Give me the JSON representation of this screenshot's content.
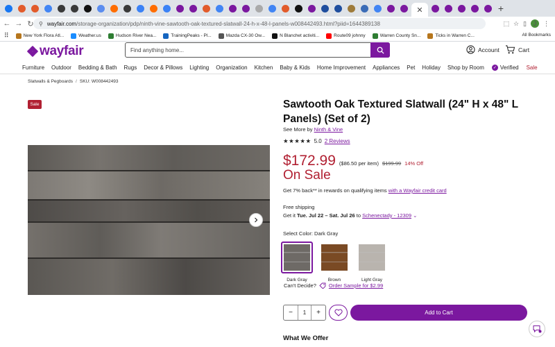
{
  "browser": {
    "tab_colors": [
      "#1877f2",
      "#e25b2b",
      "#e25b2b",
      "#4285f4",
      "#3a3a3a",
      "#3a3a3a",
      "#111111",
      "#5b8def",
      "#ff6d00",
      "#3a3a3a",
      "#3b82f6",
      "#ff6d00",
      "#3b82f6",
      "#7b189f",
      "#7b189f",
      "#e25b2b",
      "#4285f4",
      "#7b189f",
      "#7b189f",
      "#aaaaaa",
      "#4285f4",
      "#e25b2b",
      "#111111",
      "#7b189f",
      "#1f4e9e",
      "#1f4e9e",
      "#9e7b3b",
      "#3b6cb7",
      "#4285f4",
      "#7b189f",
      "#7b189f",
      "#7b189f",
      "#7b189f",
      "#7b189f",
      "#7b189f",
      "#7b189f",
      "#7b189f"
    ],
    "url_host": "wayfair.com",
    "url_path": "/storage-organization/pdp/ninth-vine-sawtooth-oak-textured-slatwall-24-h-x-48-l-panels-w008442493.html?piid=1644389138",
    "profile_initial": "J",
    "bookmarks": [
      {
        "label": "New York Flora Atl...",
        "color": "#b6761d"
      },
      {
        "label": "Weather.us",
        "color": "#1a8cff"
      },
      {
        "label": "Hudson River Nea...",
        "color": "#2e7d32"
      },
      {
        "label": "TrainingPeaks - Pl...",
        "color": "#1565c0"
      },
      {
        "label": "Mazda CX-30 Ow...",
        "color": "#555555"
      },
      {
        "label": "N Blanchet activiti...",
        "color": "#111111"
      },
      {
        "label": "Route09 johnny",
        "color": "#ff0000"
      },
      {
        "label": "Warren County Sn...",
        "color": "#2e7d32"
      },
      {
        "label": "Ticks in Warren C...",
        "color": "#b6761d"
      }
    ],
    "all_bookmarks": "All Bookmarks"
  },
  "header": {
    "logo": "wayfair",
    "search_placeholder": "Find anything home...",
    "account": "Account",
    "cart": "Cart"
  },
  "nav": {
    "categories": [
      "Furniture",
      "Outdoor",
      "Bedding & Bath",
      "Rugs",
      "Decor & Pillows",
      "Lighting",
      "Organization",
      "Kitchen",
      "Baby & Kids",
      "Home Improvement",
      "Appliances",
      "Pet",
      "Holiday",
      "Shop by Room"
    ],
    "verified": "Verified",
    "sale": "Sale"
  },
  "breadcrumb": {
    "crumb": "Slatwalls & Pegboards",
    "sku": "SKU: W008442493"
  },
  "product": {
    "sale_badge": "Sale",
    "title": "Sawtooth Oak Textured Slatwall (24\" H x 48\" L Panels) (Set of 2)",
    "see_more_prefix": "See More by",
    "brand": "Ninth & Vine",
    "rating": "5.0",
    "reviews": "2 Reviews",
    "stars": "★★★★★",
    "price": "$172.99",
    "per_item": "($86.50 per item)",
    "was_price": "$199.99",
    "percent_off": "14% Off",
    "on_sale": "On Sale",
    "rewards_text": "Get 7% back** in rewards on qualifying items",
    "rewards_link": "with a Wayfair credit card",
    "shipping_label": "Free shipping",
    "get_it_prefix": "Get it",
    "delivery_dates": "Tue. Jul 22 – Sat. Jul 26",
    "to_word": "to",
    "zip_link": "Schenectady - 12309",
    "select_color_label": "Select Color:",
    "selected_color": "Dark Gray",
    "swatches": [
      {
        "label": "Dark Gray",
        "color": "#6e6a66"
      },
      {
        "label": "Brown",
        "color": "#7a4a24"
      },
      {
        "label": "Light Gray",
        "color": "#b9b4ae"
      }
    ],
    "cant_decide": "Can't Decide?",
    "order_sample": "Order Sample for $2.99",
    "quantity": "1",
    "add_to_cart": "Add to Cart",
    "what_we_offer": "What We Offer"
  },
  "colors": {
    "brand": "#7b189f",
    "sale_red": "#b12032"
  }
}
